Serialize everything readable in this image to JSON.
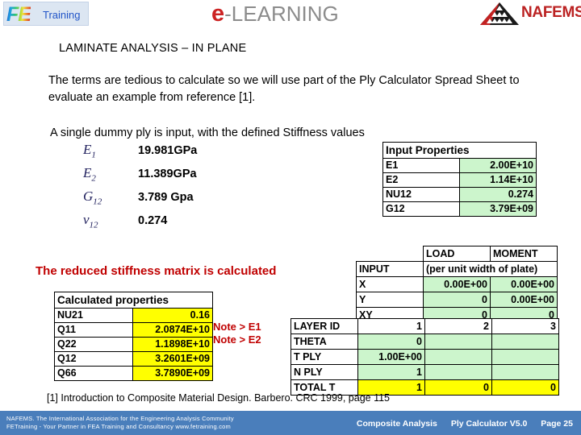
{
  "header": {
    "fe_logo": {
      "letters": "FE",
      "word": "Training"
    },
    "elearning_logo": {
      "e": "e",
      "rest": "-LEARNING"
    },
    "nafems_logo": {
      "word": "NAFEMS"
    }
  },
  "slide": {
    "title": "LAMINATE ANALYSIS – IN PLANE",
    "paragraph_1": "The terms are tedious to calculate so we will use part of the Ply Calculator Spread Sheet to evaluate an example from reference [1].",
    "paragraph_2": "A  single dummy ply is input, with the defined Stiffness values",
    "reduced_heading": "The reduced stiffness matrix is calculated",
    "note_line_1": "Note > E1",
    "note_line_2": "Note > E2",
    "reference": "[1] Introduction to Composite Material Design. Barbero. CRC 1999, page 115"
  },
  "stiffness_list": [
    {
      "symbol": "E",
      "subscript": "1",
      "value": "19.981GPa"
    },
    {
      "symbol": "E",
      "subscript": "2",
      "value": "11.389GPa"
    },
    {
      "symbol": "G",
      "subscript": "12",
      "value": "3.789  Gpa"
    },
    {
      "symbol": "ν",
      "subscript": "12",
      "value": "0.274"
    }
  ],
  "input_properties": {
    "title": "Input Properties",
    "rows": [
      {
        "label": "E1",
        "value": "2.00E+10"
      },
      {
        "label": "E2",
        "value": "1.14E+10"
      },
      {
        "label": "NU12",
        "value": "0.274"
      },
      {
        "label": "G12",
        "value": "3.79E+09"
      }
    ]
  },
  "calculated_properties": {
    "title": "Calculated properties",
    "rows": [
      {
        "label": "NU21",
        "value": "0.16"
      },
      {
        "label": "Q11",
        "value": "2.0874E+10"
      },
      {
        "label": "Q22",
        "value": "1.1898E+10"
      },
      {
        "label": "Q12",
        "value": "3.2601E+09"
      },
      {
        "label": "Q66",
        "value": "3.7890E+09"
      }
    ]
  },
  "load_moment_table": {
    "header": {
      "blank": "",
      "load": "LOAD",
      "moment": "MOMENT"
    },
    "input_row": {
      "label": "INPUT",
      "span_text": "(per unit width of plate)"
    },
    "rows": [
      {
        "label": "X",
        "load": "0.00E+00",
        "moment": "0.00E+00"
      },
      {
        "label": "Y",
        "load": "0",
        "moment": "0.00E+00"
      },
      {
        "label": "XY",
        "load": "0",
        "moment": "0"
      }
    ]
  },
  "layer_table": {
    "rows": [
      {
        "label": "LAYER ID",
        "c1": "1",
        "c2": "2",
        "c3": "3",
        "style": "white"
      },
      {
        "label": "THETA",
        "c1": "0",
        "c2": "",
        "c3": "",
        "style": "green"
      },
      {
        "label": "T PLY",
        "c1": "1.00E+00",
        "c2": "",
        "c3": "",
        "style": "green"
      },
      {
        "label": "N PLY",
        "c1": "1",
        "c2": "",
        "c3": "",
        "style": "green"
      },
      {
        "label": "TOTAL  T",
        "c1": "1",
        "c2": "0",
        "c3": "0",
        "style": "yellow"
      }
    ]
  },
  "footer": {
    "line_1": "NAFEMS. The International Association for the Engineering Analysis Community",
    "line_2": "FETraining -  Your Partner in FEA  Training and Consultancy  www.fetraining.com",
    "course": "Composite Analysis",
    "module": "Ply Calculator  V5.0",
    "page": "Page 25"
  },
  "colors": {
    "input_green": "#ccf5cc",
    "calc_yellow": "#ffff00",
    "note_red": "#c00000",
    "footer_blue": "#4a7ebb",
    "symbol_navy": "#21215e"
  }
}
